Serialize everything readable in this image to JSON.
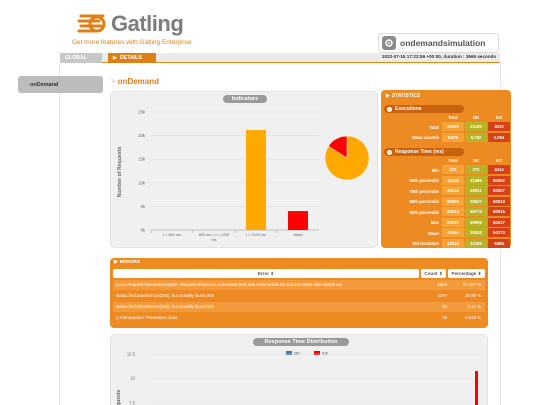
{
  "header": {
    "brand": "Gatling",
    "enterprise_link": "Get more features with Gatling Enterprise",
    "simulation_name": "ondemandsimulation"
  },
  "tabs": {
    "global": "GLOBAL",
    "details": "DETAILS"
  },
  "run_info": "2022-07-15 17:22:56 +00:00, duration : 3665 seconds",
  "sidebar": {
    "items": [
      {
        "label": "onDemand"
      }
    ]
  },
  "section_title": "onDemand",
  "indicators": {
    "title": "Indicators",
    "chart_data": {
      "type": "bar",
      "categories": [
        "t < 800 ms",
        "800 ms < t < 1200 ms",
        "t > 1200 ms",
        "failed"
      ],
      "values": [
        0,
        0,
        21180,
        4010
      ],
      "colors": [
        "#68b65c",
        "#ffdd00",
        "#ffa900",
        "#ff0000"
      ],
      "ylabel": "Number of Requests",
      "ylim": [
        0,
        25000
      ],
      "yticks": [
        "0k",
        "5k",
        "10k",
        "15k",
        "20k",
        "25k"
      ],
      "pie": {
        "values": [
          21180,
          4010
        ],
        "colors": [
          "#ffa900",
          "#ff0000"
        ]
      }
    }
  },
  "statistics": {
    "title": "STATISTICS",
    "executions": {
      "title": "Executions",
      "columns": [
        "Total",
        "OK",
        "KO"
      ],
      "rows": [
        {
          "label": "Total",
          "total": "25200",
          "ok": "21190",
          "ko": "4010"
        },
        {
          "label": "Mean count/s",
          "total": "6.876",
          "ok": "5.782",
          "ko": "1.094"
        }
      ]
    },
    "response_time": {
      "title": "Response Time (ms)",
      "columns": [
        "Total",
        "OK",
        "KO"
      ],
      "rows": [
        {
          "label": "Min",
          "total": "272",
          "ok": "272",
          "ko": "4414"
        },
        {
          "label": "50th percentile",
          "total": "42220",
          "ok": "41596",
          "ko": "60002"
        },
        {
          "label": "75th percentile",
          "total": "49216",
          "ok": "45911",
          "ko": "60007"
        },
        {
          "label": "95th percentile",
          "total": "60000",
          "ok": "50527",
          "ko": "60013"
        },
        {
          "label": "99th percentile",
          "total": "60013",
          "ok": "56774",
          "ko": "60015"
        },
        {
          "label": "Max",
          "total": "60037",
          "ok": "59998",
          "ko": "60037"
        },
        {
          "label": "Mean",
          "total": "41894",
          "ok": "38533",
          "ko": "54373"
        },
        {
          "label": "Std Deviation",
          "total": "12816",
          "ok": "12199",
          "ko": "9408"
        }
      ]
    }
  },
  "errors": {
    "title": "ERRORS",
    "columns": {
      "error": "Error ⇕",
      "count": "Count ⇕",
      "percentage": "Percentage ⇕"
    },
    "rows": [
      {
        "message": "j.u.c.i.RequestTimeoutException: Request timeout to ondemand-perf.aws.mobi.to/269.63.103.215:6080 after 60000 ms",
        "count": "2609",
        "pct": "67.207 %"
      },
      {
        "message": "status.find.transform.in(200), but actually found 504",
        "count": "1197",
        "pct": "29.85 %"
      },
      {
        "message": "status.find.transform.in(200), but actually found 500",
        "count": "85",
        "pct": "2.12 %"
      },
      {
        "message": "j.i.IOException: Premature close",
        "count": "33",
        "pct": "0.823 %"
      }
    ]
  },
  "distribution": {
    "title": "Response Time Distribution",
    "legend": [
      {
        "name": "OK",
        "color": "#4572a7"
      },
      {
        "name": "KO",
        "color": "#ff0000"
      }
    ],
    "ylabel": "Requests",
    "yticks": [
      "12.5",
      "10",
      "7.5"
    ]
  }
}
